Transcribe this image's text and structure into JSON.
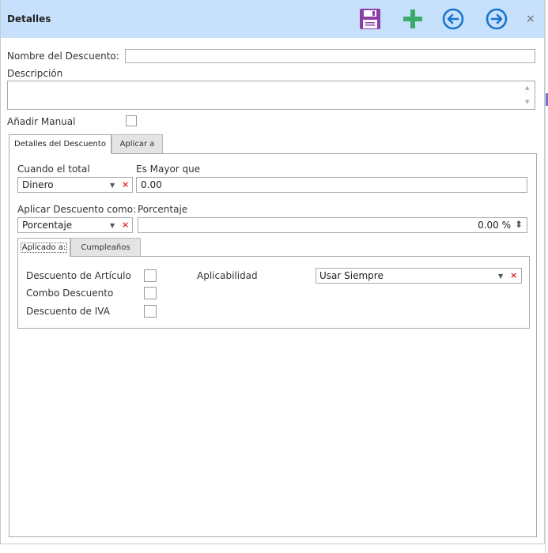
{
  "window": {
    "title": "Detalles",
    "close_label": "×"
  },
  "toolbar": {
    "save_icon": "floppy-disk-icon",
    "add_icon": "plus-icon",
    "prev_icon": "circle-arrow-left-icon",
    "next_icon": "circle-arrow-right-icon"
  },
  "form": {
    "nombre_label": "Nombre del Descuento:",
    "nombre_value": "",
    "descripcion_label": "Descripción",
    "descripcion_value": "",
    "manual_label": "Añadir Manual",
    "manual_checked": false
  },
  "outer_tabs": [
    {
      "label": "Detalles del Descuento",
      "active": true
    },
    {
      "label": "Aplicar a",
      "active": false
    }
  ],
  "details": {
    "cuando_label": "Cuando el total",
    "cuando_value": "Dinero",
    "mayor_label": "Es Mayor que",
    "mayor_value": "0.00",
    "aplicar_label": "Aplicar Descuento como:",
    "aplicar_value": "Porcentaje",
    "porcentaje_label": "Porcentaje",
    "porcentaje_value": "0.00 %"
  },
  "inner_tabs": [
    {
      "label": "Aplicado a:",
      "active": true
    },
    {
      "label": "Cumpleaños",
      "active": false
    }
  ],
  "applied": {
    "articulo_label": "Descuento de Artículo",
    "combo_label": "Combo Descuento",
    "iva_label": "Descuento de IVA",
    "aplicabilidad_label": "Aplicabilidad",
    "aplicabilidad_value": "Usar Siempre"
  },
  "glyphs": {
    "dropdown_arrow": "▼",
    "clear": "×",
    "spin": "⬍"
  },
  "colors": {
    "titlebar": "#c7e0fb",
    "save": "#8b3fa6",
    "add": "#3aaa6b",
    "nav": "#1874cd",
    "clear": "#e02020"
  }
}
